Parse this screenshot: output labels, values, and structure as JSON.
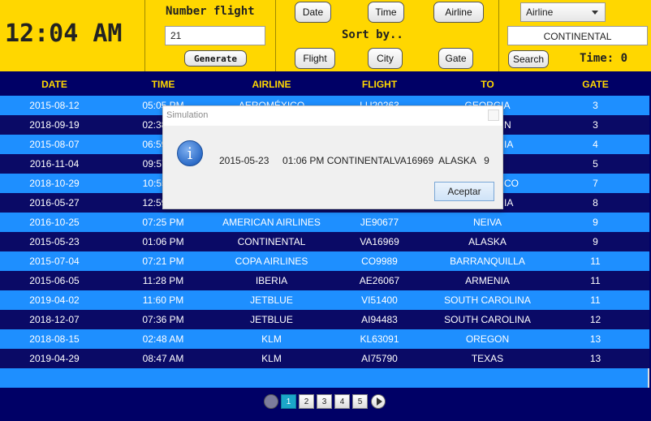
{
  "header": {
    "clock": "12:04 AM",
    "number_flight_label": "Number flight",
    "number_flight_value": "21",
    "generate_label": "Generate",
    "sort_label": "Sort by..",
    "sort_buttons": [
      "Date",
      "Time",
      "Airline",
      "Flight",
      "City",
      "Gate"
    ],
    "filter_select": "Airline",
    "search_value": "CONTINENTAL",
    "search_label": "Search",
    "time_label": "Time: 0"
  },
  "table": {
    "columns": [
      "DATE",
      "TIME",
      "AIRLINE",
      "FLIGHT",
      "TO",
      "GATE"
    ],
    "rows": [
      [
        "2015-08-12",
        "05:05 PM",
        "AEROMÉXICO",
        "LU20263",
        "GEORGIA",
        "3"
      ],
      [
        "2018-09-19",
        "02:38 PM",
        "",
        "",
        "",
        "3"
      ],
      [
        "2015-08-07",
        "06:59 PM",
        "",
        "",
        "",
        "4"
      ],
      [
        "2016-11-04",
        "09:57 AM",
        "",
        "",
        "",
        "5"
      ],
      [
        "2018-10-29",
        "10:55 AM",
        "",
        "",
        "",
        "7"
      ],
      [
        "2016-05-27",
        "12:59 PM",
        "",
        "",
        "",
        "8"
      ],
      [
        "2016-10-25",
        "07:25 PM",
        "AMERICAN AIRLINES",
        "JE90677",
        "NEIVA",
        "9"
      ],
      [
        "2015-05-23",
        "01:06 PM",
        "CONTINENTAL",
        "VA16969",
        "ALASKA",
        "9"
      ],
      [
        "2015-07-04",
        "07:21 PM",
        "COPA AIRLINES",
        "CO9989",
        "BARRANQUILLA",
        "11"
      ],
      [
        "2015-06-05",
        "11:28 PM",
        "IBERIA",
        "AE26067",
        "ARMENIA",
        "11"
      ],
      [
        "2019-04-02",
        "11:60 PM",
        "JETBLUE",
        "VI51400",
        "SOUTH CAROLINA",
        "11"
      ],
      [
        "2018-12-07",
        "07:36 PM",
        "JETBLUE",
        "AI94483",
        "SOUTH CAROLINA",
        "12"
      ],
      [
        "2018-08-15",
        "02:48 AM",
        "KLM",
        "KL63091",
        "OREGON",
        "13"
      ],
      [
        "2019-04-29",
        "08:47 AM",
        "KLM",
        "AI75790",
        "TEXAS",
        "13"
      ]
    ],
    "partial_right": [
      "",
      "N",
      "IA",
      "",
      "CO",
      "IA"
    ]
  },
  "pager": {
    "pages": [
      "1",
      "2",
      "3",
      "4",
      "5"
    ],
    "active_page": "1"
  },
  "dialog": {
    "title": "Simulation",
    "message": "2015-05-23     01:06 PM CONTINENTALVA16969  ALASKA   9",
    "ok_label": "Aceptar"
  }
}
